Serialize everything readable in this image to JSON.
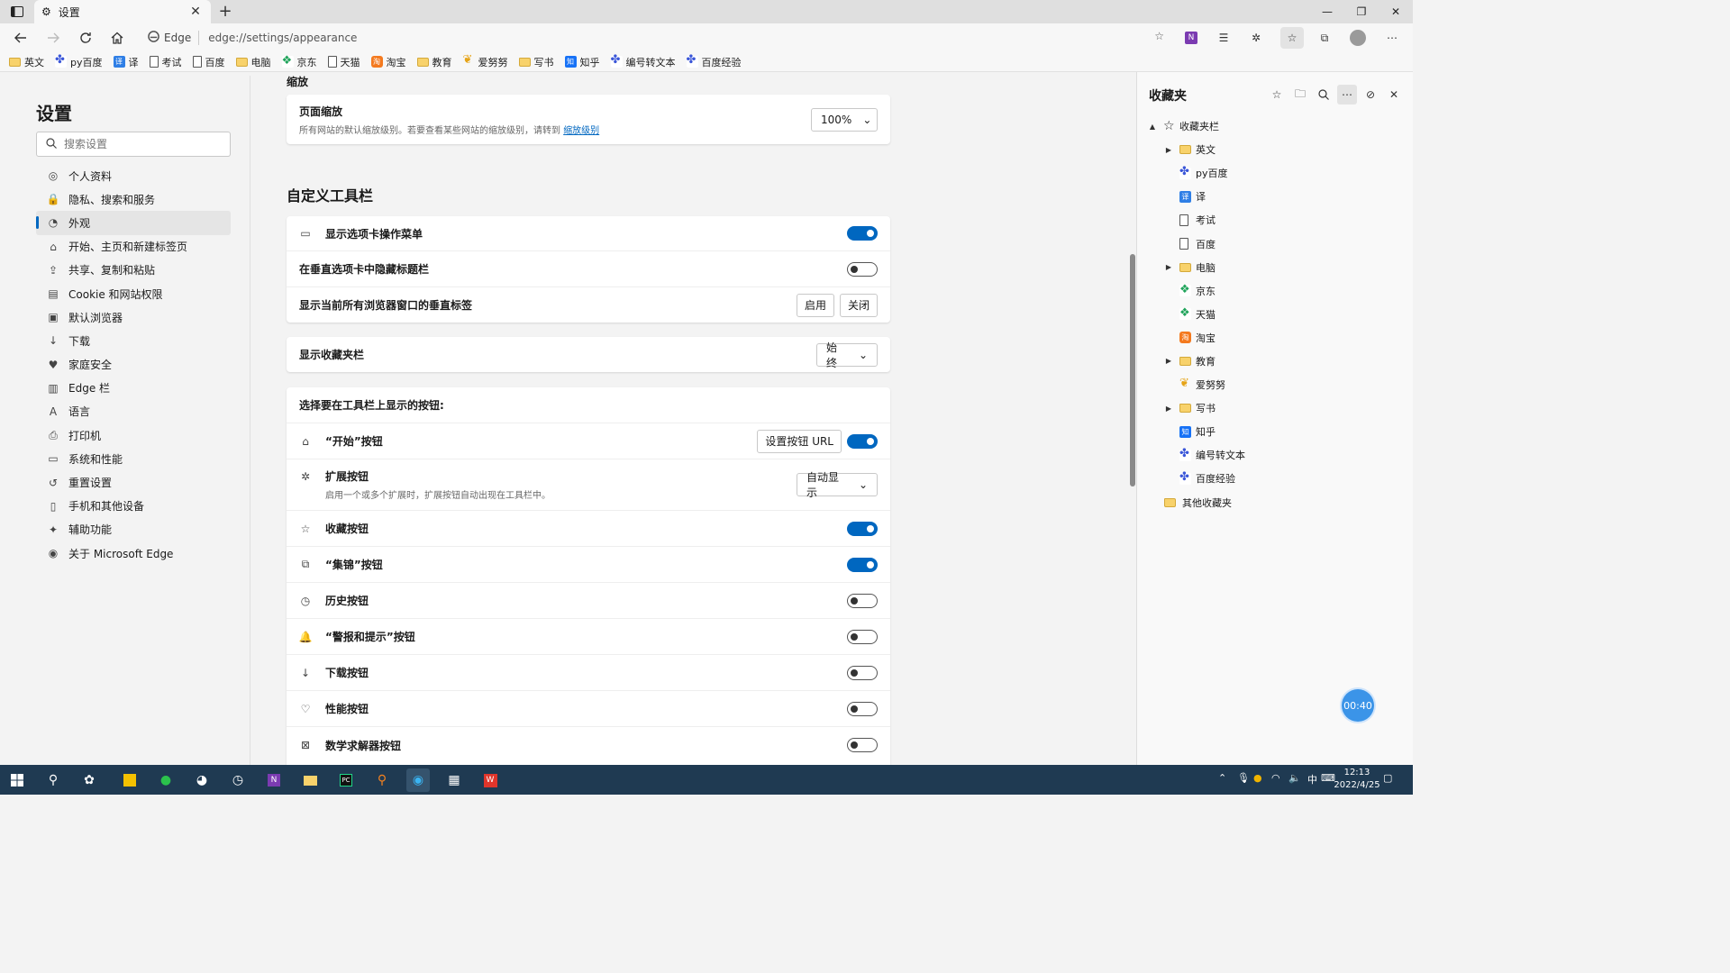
{
  "browser": {
    "tab_title": "设置",
    "address_brand": "Edge",
    "address_url": "edge://settings/appearance"
  },
  "favbar": [
    {
      "label": "英文",
      "icon": "folder"
    },
    {
      "label": "py百度",
      "icon": "paw"
    },
    {
      "label": "译",
      "icon": "yi"
    },
    {
      "label": "考试",
      "icon": "page"
    },
    {
      "label": "百度",
      "icon": "page"
    },
    {
      "label": "电脑",
      "icon": "folder"
    },
    {
      "label": "京东",
      "icon": "jd"
    },
    {
      "label": "天猫",
      "icon": "page"
    },
    {
      "label": "淘宝",
      "icon": "tb"
    },
    {
      "label": "教育",
      "icon": "folder"
    },
    {
      "label": "爱努努",
      "icon": "ai"
    },
    {
      "label": "写书",
      "icon": "folder"
    },
    {
      "label": "知乎",
      "icon": "zh"
    },
    {
      "label": "编号转文本",
      "icon": "paw"
    },
    {
      "label": "百度经验",
      "icon": "paw"
    }
  ],
  "leftnav": {
    "title": "设置",
    "search_placeholder": "搜索设置",
    "items": [
      {
        "label": "个人资料",
        "icon": "profile-icon"
      },
      {
        "label": "隐私、搜索和服务",
        "icon": "lock-icon"
      },
      {
        "label": "外观",
        "icon": "appearance-icon",
        "selected": true
      },
      {
        "label": "开始、主页和新建标签页",
        "icon": "start-icon"
      },
      {
        "label": "共享、复制和粘贴",
        "icon": "share-icon"
      },
      {
        "label": "Cookie 和网站权限",
        "icon": "cookie-icon"
      },
      {
        "label": "默认浏览器",
        "icon": "browser-icon"
      },
      {
        "label": "下载",
        "icon": "download-icon"
      },
      {
        "label": "家庭安全",
        "icon": "family-icon"
      },
      {
        "label": "Edge 栏",
        "icon": "edge-bar-icon"
      },
      {
        "label": "语言",
        "icon": "language-icon"
      },
      {
        "label": "打印机",
        "icon": "printer-icon"
      },
      {
        "label": "系统和性能",
        "icon": "system-icon"
      },
      {
        "label": "重置设置",
        "icon": "reset-icon"
      },
      {
        "label": "手机和其他设备",
        "icon": "phone-icon"
      },
      {
        "label": "辅助功能",
        "icon": "accessibility-icon"
      },
      {
        "label": "关于 Microsoft Edge",
        "icon": "edge-logo-icon"
      }
    ]
  },
  "main": {
    "zoom_section": "缩放",
    "zoom_label": "页面缩放",
    "zoom_desc": "所有网站的默认缩放级别。若要查看某些网站的缩放级别，请转到",
    "zoom_link": "缩放级别",
    "zoom_value": "100%",
    "toolbar_heading": "自定义工具栏",
    "tab_menu_label": "显示选项卡操作菜单",
    "tab_menu_on": true,
    "hide_title_label": "在垂直选项卡中隐藏标题栏",
    "hide_title_on": false,
    "vertical_tabs_label": "显示当前所有浏览器窗口的垂直标签",
    "enable_label": "启用",
    "disable_label": "关闭",
    "favbar_label": "显示收藏夹栏",
    "favbar_value": "始终",
    "buttons_header": "选择要在工具栏上显示的按钮:",
    "home_label": "“开始”按钮",
    "home_url_btn": "设置按钮 URL",
    "home_on": true,
    "ext_label": "扩展按钮",
    "ext_desc": "启用一个或多个扩展时，扩展按钮自动出现在工具栏中。",
    "ext_value": "自动显示",
    "buttons": [
      {
        "label": "收藏按钮",
        "on": true,
        "icon": "favorites-icon"
      },
      {
        "label": "“集锦”按钮",
        "on": true,
        "icon": "collections-icon"
      },
      {
        "label": "历史按钮",
        "on": false,
        "icon": "history-icon"
      },
      {
        "label": "“警报和提示”按钮",
        "on": false,
        "icon": "bell-icon"
      },
      {
        "label": "下载按钮",
        "on": false,
        "icon": "download-icon"
      },
      {
        "label": "性能按钮",
        "on": false,
        "icon": "performance-icon"
      },
      {
        "label": "数学求解器按钮",
        "on": false,
        "icon": "math-icon"
      }
    ]
  },
  "favpane": {
    "title": "收藏夹",
    "tree": [
      {
        "label": "收藏夹栏",
        "level": 0,
        "icon": "star",
        "caret": "▲"
      },
      {
        "label": "英文",
        "level": 1,
        "icon": "folder",
        "caret": "▶"
      },
      {
        "label": "py百度",
        "level": 1,
        "icon": "paw"
      },
      {
        "label": "译",
        "level": 1,
        "icon": "yi"
      },
      {
        "label": "考试",
        "level": 1,
        "icon": "page"
      },
      {
        "label": "百度",
        "level": 1,
        "icon": "page"
      },
      {
        "label": "电脑",
        "level": 1,
        "icon": "folder",
        "caret": "▶"
      },
      {
        "label": "京东",
        "level": 1,
        "icon": "jd"
      },
      {
        "label": "天猫",
        "level": 1,
        "icon": "jd"
      },
      {
        "label": "淘宝",
        "level": 1,
        "icon": "tb"
      },
      {
        "label": "教育",
        "level": 1,
        "icon": "folder",
        "caret": "▶"
      },
      {
        "label": "爱努努",
        "level": 1,
        "icon": "ai"
      },
      {
        "label": "写书",
        "level": 1,
        "icon": "folder",
        "caret": "▶"
      },
      {
        "label": "知乎",
        "level": 1,
        "icon": "zh"
      },
      {
        "label": "编号转文本",
        "level": 1,
        "icon": "paw"
      },
      {
        "label": "百度经验",
        "level": 1,
        "icon": "paw"
      },
      {
        "label": "其他收藏夹",
        "level": 0,
        "icon": "folder"
      }
    ]
  },
  "timer": "00:40",
  "taskbar": {
    "time": "12:13",
    "date": "2022/4/25",
    "ime": "中"
  }
}
